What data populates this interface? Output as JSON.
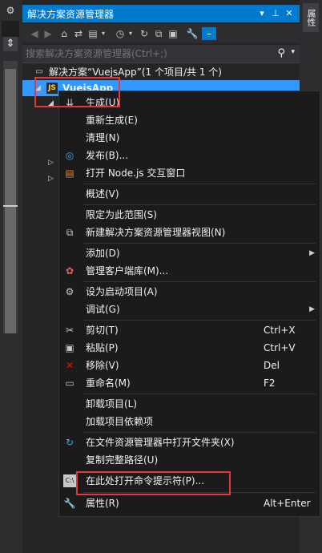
{
  "panel_title": "解决方案资源管理器",
  "right_tab": "属性",
  "search_placeholder": "搜索解决方案资源管理器(Ctrl+;)",
  "tree": {
    "solution": "解决方案“VuejsApp”(1 个项目/共 1 个)",
    "project": "VuejsApp"
  },
  "menu": [
    {
      "name": "build",
      "label": "生成(U)",
      "icon": "build-icon"
    },
    {
      "name": "rebuild",
      "label": "重新生成(E)"
    },
    {
      "name": "clean",
      "label": "清理(N)"
    },
    {
      "name": "publish",
      "label": "发布(B)...",
      "icon": "globe-icon"
    },
    {
      "name": "open-node",
      "label": "打开 Node.js 交互窗口",
      "icon": "node-window-icon"
    },
    {
      "name": "overview",
      "label": "概述(V)"
    },
    {
      "name": "scope",
      "label": "限定为此范围(S)"
    },
    {
      "name": "new-view",
      "label": "新建解决方案资源管理器视图(N)",
      "icon": "new-view-icon"
    },
    {
      "name": "add",
      "label": "添加(D)",
      "submenu": true
    },
    {
      "name": "client-libs",
      "label": "管理客户端库(M)...",
      "icon": "libs-icon"
    },
    {
      "name": "startup",
      "label": "设为启动项目(A)",
      "icon": "gear-icon"
    },
    {
      "name": "debug",
      "label": "调试(G)",
      "submenu": true
    },
    {
      "name": "cut",
      "label": "剪切(T)",
      "shortcut": "Ctrl+X",
      "icon": "scissors-icon"
    },
    {
      "name": "paste",
      "label": "粘贴(P)",
      "shortcut": "Ctrl+V",
      "icon": "paste-icon"
    },
    {
      "name": "remove",
      "label": "移除(V)",
      "shortcut": "Del",
      "icon": "remove-icon"
    },
    {
      "name": "rename",
      "label": "重命名(M)",
      "shortcut": "F2",
      "icon": "rename-icon"
    },
    {
      "name": "unload",
      "label": "卸载项目(L)"
    },
    {
      "name": "load-deps",
      "label": "加载项目依赖项"
    },
    {
      "name": "open-folder",
      "label": "在文件资源管理器中打开文件夹(X)",
      "icon": "refresh-icon"
    },
    {
      "name": "copy-path",
      "label": "复制完整路径(U)"
    },
    {
      "name": "open-cmd",
      "label": "在此处打开命令提示符(P)...",
      "icon": "cmd-icon"
    },
    {
      "name": "properties",
      "label": "属性(R)",
      "shortcut": "Alt+Enter",
      "icon": "wrench-icon"
    }
  ],
  "colors": {
    "accent": "#007acc",
    "selection": "#3399ff",
    "highlight_box": "#e0383e",
    "remove_icon": "#e51400"
  }
}
